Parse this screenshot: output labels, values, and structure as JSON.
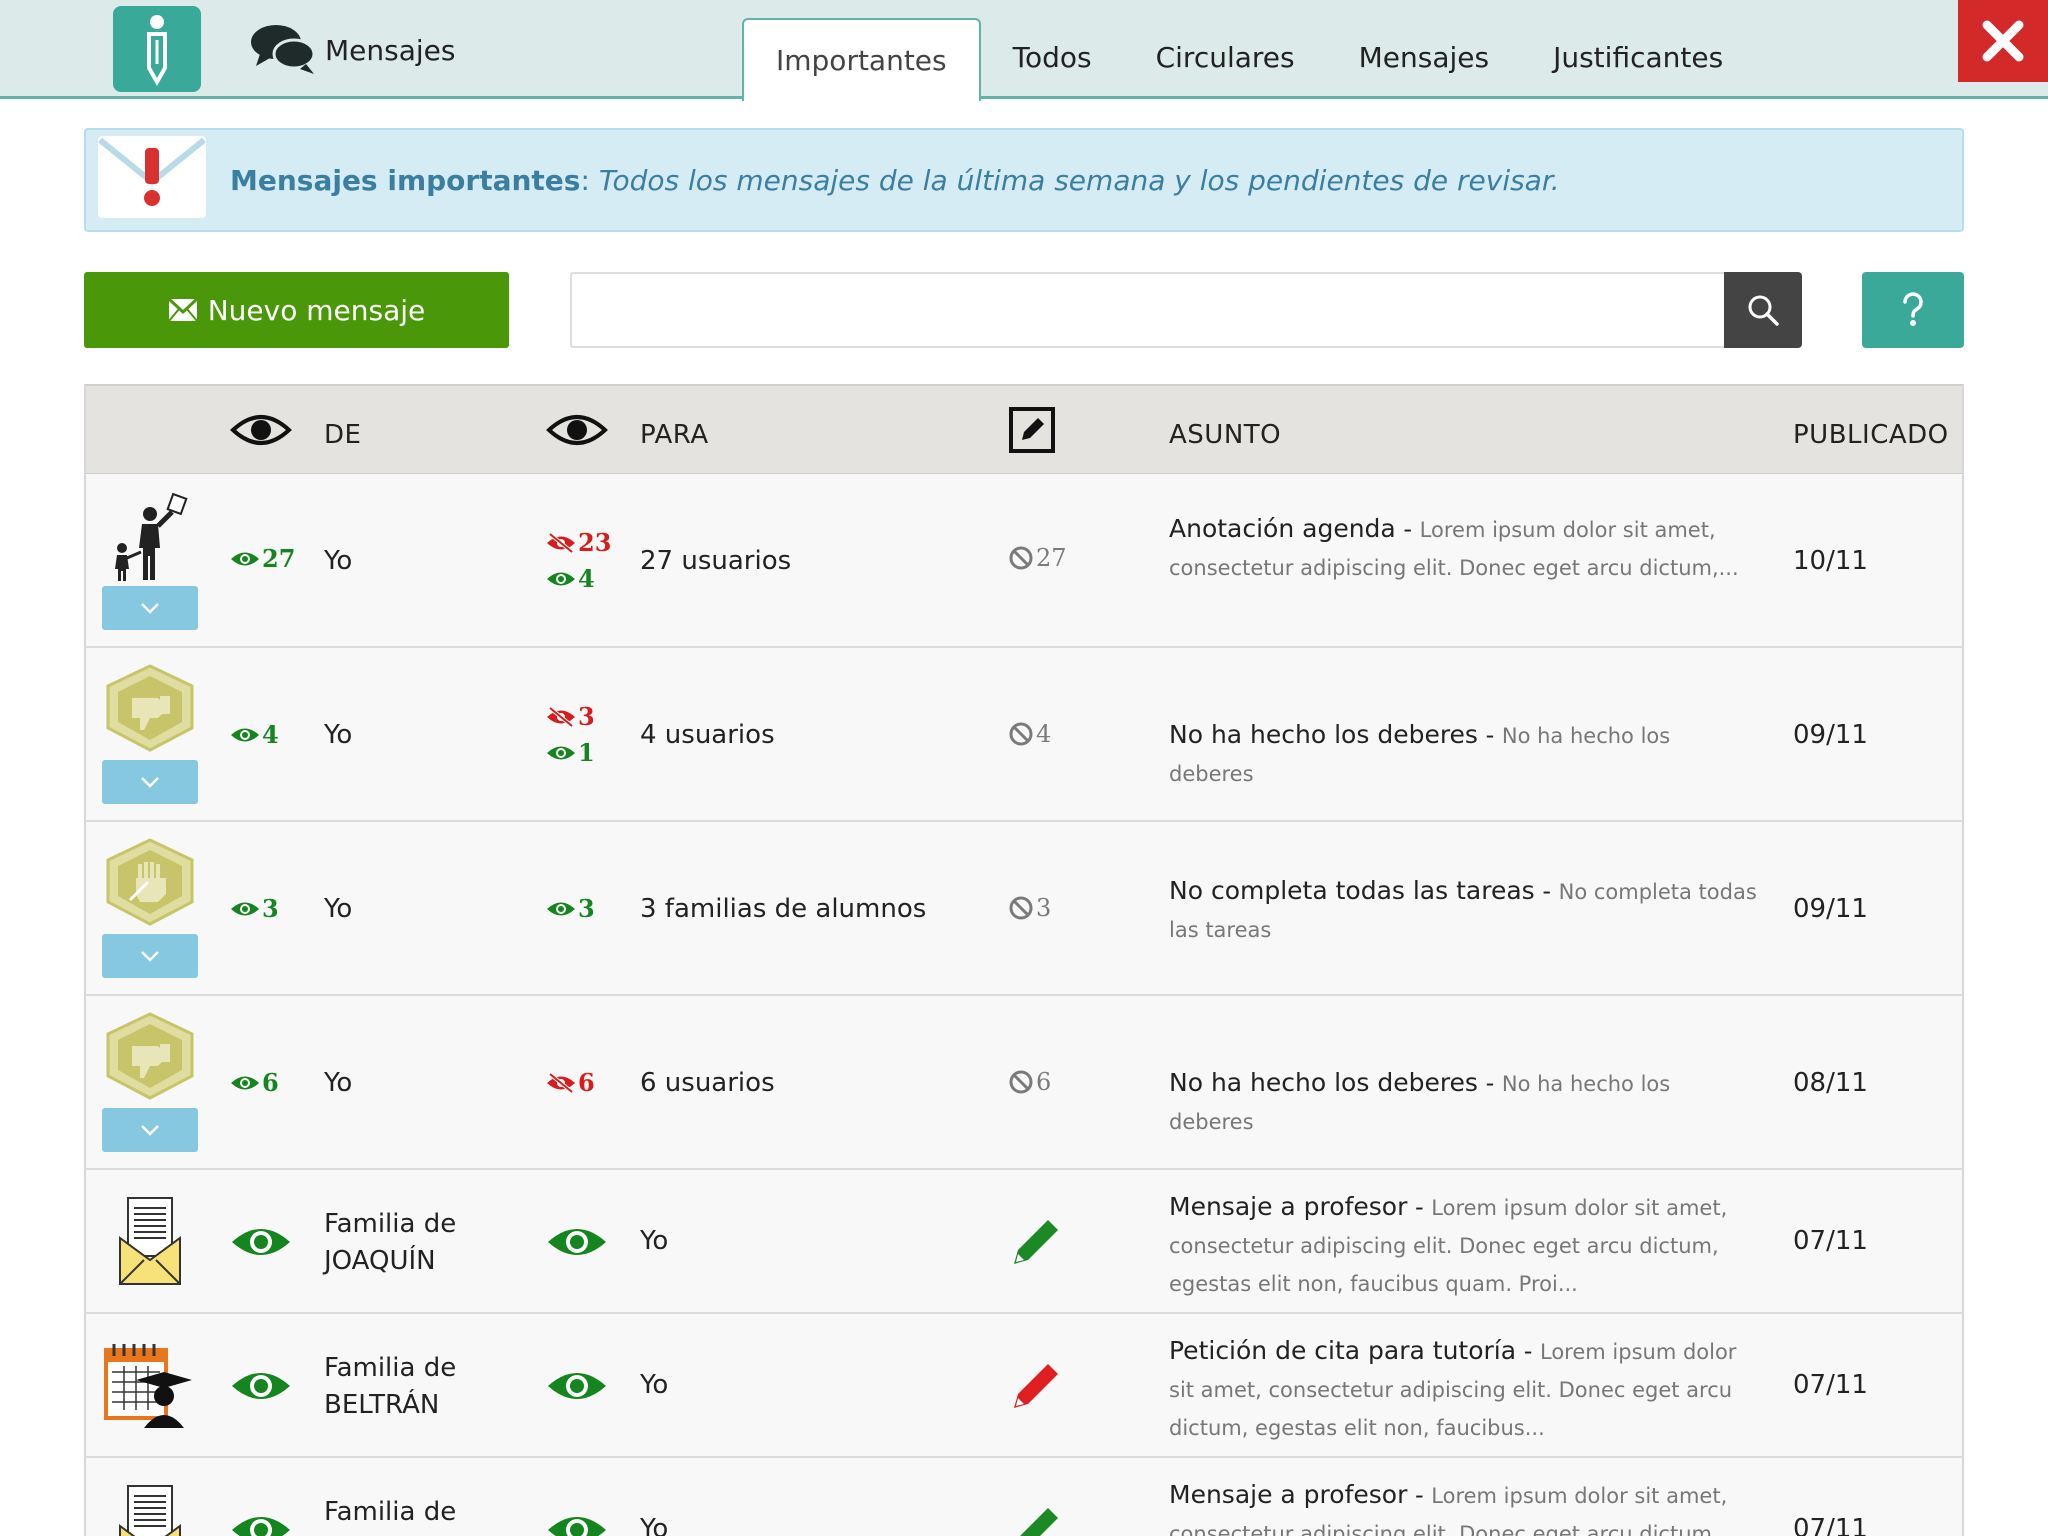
{
  "header": {
    "brand_label": "Mensajes",
    "tabs": [
      {
        "label": "Importantes",
        "active": true
      },
      {
        "label": "Todos",
        "active": false
      },
      {
        "label": "Circulares",
        "active": false
      },
      {
        "label": "Mensajes",
        "active": false
      },
      {
        "label": "Justificantes",
        "active": false
      }
    ],
    "accent_color": "#39a99a",
    "close_color": "#d42929"
  },
  "banner": {
    "title": "Mensajes importantes",
    "colon": ":",
    "text": "Todos los mensajes de la última semana y los pendientes de revisar."
  },
  "toolbar": {
    "new_label": "Nuevo mensaje",
    "search_value": "",
    "search_placeholder": ""
  },
  "table": {
    "headers": {
      "from": "DE",
      "to": "PARA",
      "subject": "ASUNTO",
      "published": "PUBLICADO"
    },
    "rows": [
      {
        "icon": "parent-child-icon",
        "from_read": "27",
        "from": "Yo",
        "to_unread": "23",
        "to_read": "4",
        "to": "27 usuarios",
        "reply_blocked": "27",
        "subject": "Anotación agenda",
        "desc": "Lorem ipsum dolor sit amet, consectetur adipiscing elit. Donec eget arcu dictum,...",
        "date": "10/11"
      },
      {
        "icon": "thumbs-down-badge-icon",
        "from_read": "4",
        "from": "Yo",
        "to_unread": "3",
        "to_read": "1",
        "to": "4 usuarios",
        "reply_blocked": "4",
        "subject": "No ha hecho los deberes",
        "desc": "No ha hecho los deberes",
        "date": "09/11"
      },
      {
        "icon": "hand-writing-badge-icon",
        "from_read": "3",
        "from": "Yo",
        "to_read": "3",
        "to": "3 familias de alumnos",
        "reply_blocked": "3",
        "subject": "No completa todas las tareas",
        "desc": "No completa todas las tareas",
        "date": "09/11"
      },
      {
        "icon": "thumbs-down-badge-icon",
        "from_read": "6",
        "from": "Yo",
        "to_unread": "6",
        "to": "6 usuarios",
        "reply_blocked": "6",
        "subject": "No ha hecho los deberes",
        "desc": "No ha hecho los deberes",
        "date": "08/11"
      },
      {
        "icon": "envelope-letter-icon",
        "from_line1": "Familia de",
        "from_line2": "JOAQUÍN",
        "to": "Yo",
        "subject": "Mensaje a profesor",
        "desc": "Lorem ipsum dolor sit amet, consectetur adipiscing elit. Donec eget arcu dictum, egestas elit non, faucibus quam. Proi...",
        "date": "07/11",
        "edit_color": "#1b8a24"
      },
      {
        "icon": "calendar-teacher-icon",
        "from_line1": "Familia de",
        "from_line2": "BELTRÁN",
        "to": "Yo",
        "subject": "Petición de cita para tutoría",
        "desc": "Lorem ipsum dolor sit amet, consectetur adipiscing elit. Donec eget arcu dictum, egestas elit non, faucibus...",
        "date": "07/11",
        "edit_color": "#e02020"
      },
      {
        "icon": "envelope-letter-icon",
        "from_line1": "Familia de",
        "to": "Yo",
        "subject": "Mensaje a profesor",
        "desc": "Lorem ipsum dolor sit amet, consectetur adipiscing elit. Donec eget arcu dictum,",
        "date": "07/11",
        "edit_color": "#1b8a24"
      }
    ],
    "sep": " - "
  }
}
